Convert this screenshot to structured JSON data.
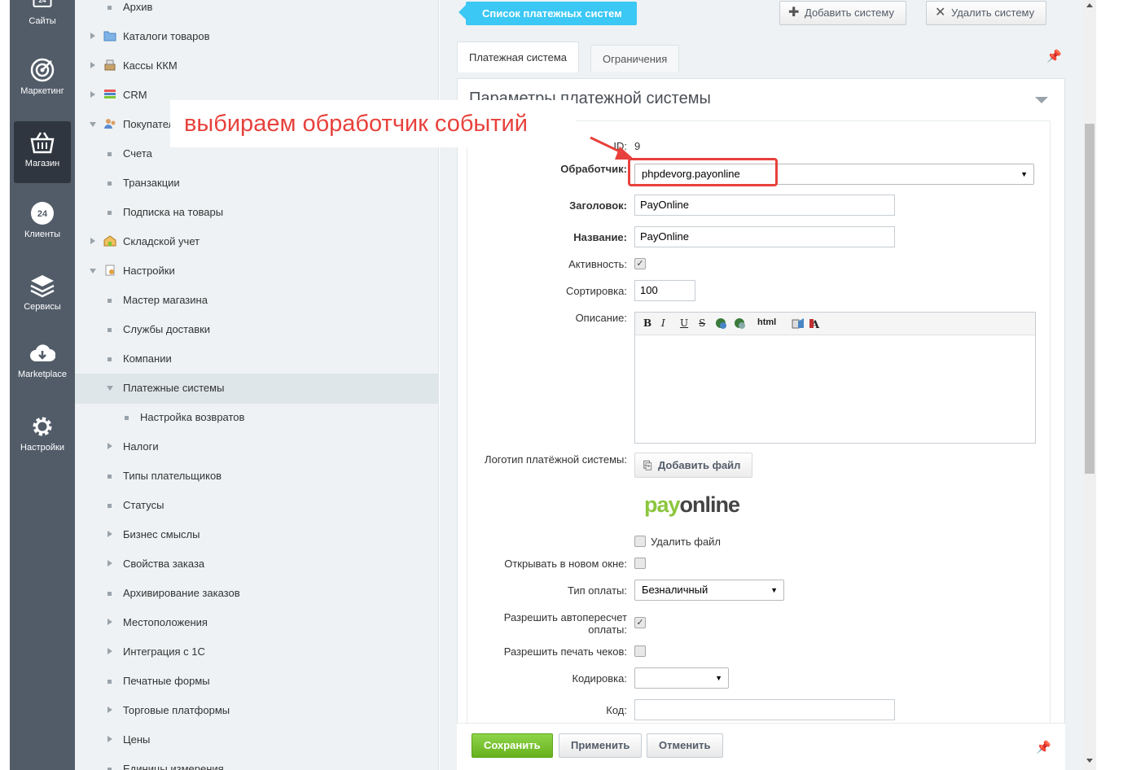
{
  "leftnav": {
    "items": [
      {
        "label": "Сайты",
        "icon": "sites-24-icon"
      },
      {
        "label": "Маркетинг",
        "icon": "target-icon"
      },
      {
        "label": "Магазин",
        "icon": "basket-icon",
        "active": true
      },
      {
        "label": "Клиенты",
        "icon": "clients-24-icon"
      },
      {
        "label": "Сервисы",
        "icon": "layers-icon"
      },
      {
        "label": "Marketplace",
        "icon": "cloud-download-icon"
      },
      {
        "label": "Настройки",
        "icon": "gear-icon"
      }
    ]
  },
  "tree": {
    "items": [
      {
        "label": "Архив"
      },
      {
        "label": "Каталоги товаров"
      },
      {
        "label": "Кассы ККМ"
      },
      {
        "label": "CRM"
      },
      {
        "label": "Покупатели"
      },
      {
        "label": "Счета"
      },
      {
        "label": "Транзакции"
      },
      {
        "label": "Подписка на товары"
      },
      {
        "label": "Складской учет"
      },
      {
        "label": "Настройки"
      },
      {
        "label": "Мастер магазина"
      },
      {
        "label": "Службы доставки"
      },
      {
        "label": "Компании"
      },
      {
        "label": "Платежные системы"
      },
      {
        "label": "Настройка возвратов"
      },
      {
        "label": "Налоги"
      },
      {
        "label": "Типы плательщиков"
      },
      {
        "label": "Статусы"
      },
      {
        "label": "Бизнес смыслы"
      },
      {
        "label": "Свойства заказа"
      },
      {
        "label": "Архивирование заказов"
      },
      {
        "label": "Местоположения"
      },
      {
        "label": "Интеграция с 1С"
      },
      {
        "label": "Печатные формы"
      },
      {
        "label": "Торговые платформы"
      },
      {
        "label": "Цены"
      },
      {
        "label": "Единицы измерения"
      }
    ]
  },
  "toolbar": {
    "back_label": "Список платежных систем",
    "add_label": "Добавить систему",
    "delete_label": "Удалить систему"
  },
  "tabs": [
    {
      "label": "Платежная система"
    },
    {
      "label": "Ограничения"
    }
  ],
  "panel": {
    "title": "Параметры платежной системы"
  },
  "form": {
    "id_label": "ID:",
    "id_value": "9",
    "handler_label": "Обработчик:",
    "handler_value": "phpdevorg.payonline",
    "header_label": "Заголовок:",
    "header_value": "PayOnline",
    "name_label": "Название:",
    "name_value": "PayOnline",
    "active_label": "Активность:",
    "sort_label": "Сортировка:",
    "sort_value": "100",
    "description_label": "Описание:",
    "editor_buttons": [
      "B",
      "I",
      "U",
      "S",
      "html"
    ],
    "logo_label": "Логотип платёжной системы:",
    "add_file_label": "Добавить файл",
    "logo_pay": "pay",
    "logo_online": "online",
    "delete_file_label": "Удалить файл",
    "new_window_label": "Открывать в новом окне:",
    "pay_type_label": "Тип оплаты:",
    "pay_type_value": "Безналичный",
    "autorecalc_label_1": "Разрешить автопересчет",
    "autorecalc_label_2": "оплаты:",
    "print_checks_label": "Разрешить печать чеков:",
    "encoding_label": "Кодировка:",
    "encoding_value": "",
    "code_label": "Код:",
    "code_value": ""
  },
  "bottom": {
    "save_label": "Сохранить",
    "apply_label": "Применить",
    "cancel_label": "Отменить"
  },
  "annotation": {
    "text": "выбираем обработчик событий"
  },
  "colors": {
    "accent": "#3bc8f5",
    "save_green": "#7bc832",
    "annotation_red": "#e8413c",
    "nav_dark": "#525c69"
  }
}
